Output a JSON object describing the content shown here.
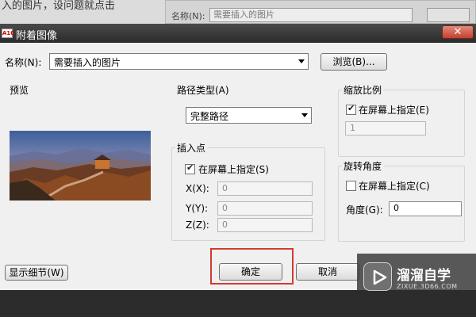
{
  "background": {
    "caption_text": "入的图片，设问题就点击",
    "dialog_label": "名称(N):",
    "dialog_value": "需要插入的图片"
  },
  "titlebar": {
    "app_icon_text": "A10",
    "title": "附着图像",
    "close_icon": "close-icon",
    "close_glyph": "✕",
    "close_color": "#c7402f"
  },
  "name_row": {
    "label": "名称(N):",
    "value": "需要插入的图片",
    "browse_label": "浏览(B)..."
  },
  "preview": {
    "title": "预览"
  },
  "path_type": {
    "title": "路径类型(A)",
    "value": "完整路径"
  },
  "insertion_point": {
    "title": "插入点",
    "checkbox_label": "在屏幕上指定(S)",
    "checked": true,
    "x_label": "X(X):",
    "x_value": "0",
    "y_label": "Y(Y):",
    "y_value": "0",
    "z_label": "Z(Z):",
    "z_value": "0"
  },
  "scale": {
    "title": "缩放比例",
    "checkbox_label": "在屏幕上指定(E)",
    "checked": true,
    "value": "1"
  },
  "rotation": {
    "title": "旋转角度",
    "checkbox_label": "在屏幕上指定(C)",
    "checked": false,
    "angle_label": "角度(G):",
    "angle_value": "0"
  },
  "footer": {
    "details_label": "显示细节(W)",
    "ok_label": "确定",
    "cancel_label": "取消",
    "ok_highlight_color": "#d23b2f"
  },
  "watermark": {
    "title": "溜溜自学",
    "url": "ZIXUE.3D66.COM",
    "icon": "play-icon"
  }
}
